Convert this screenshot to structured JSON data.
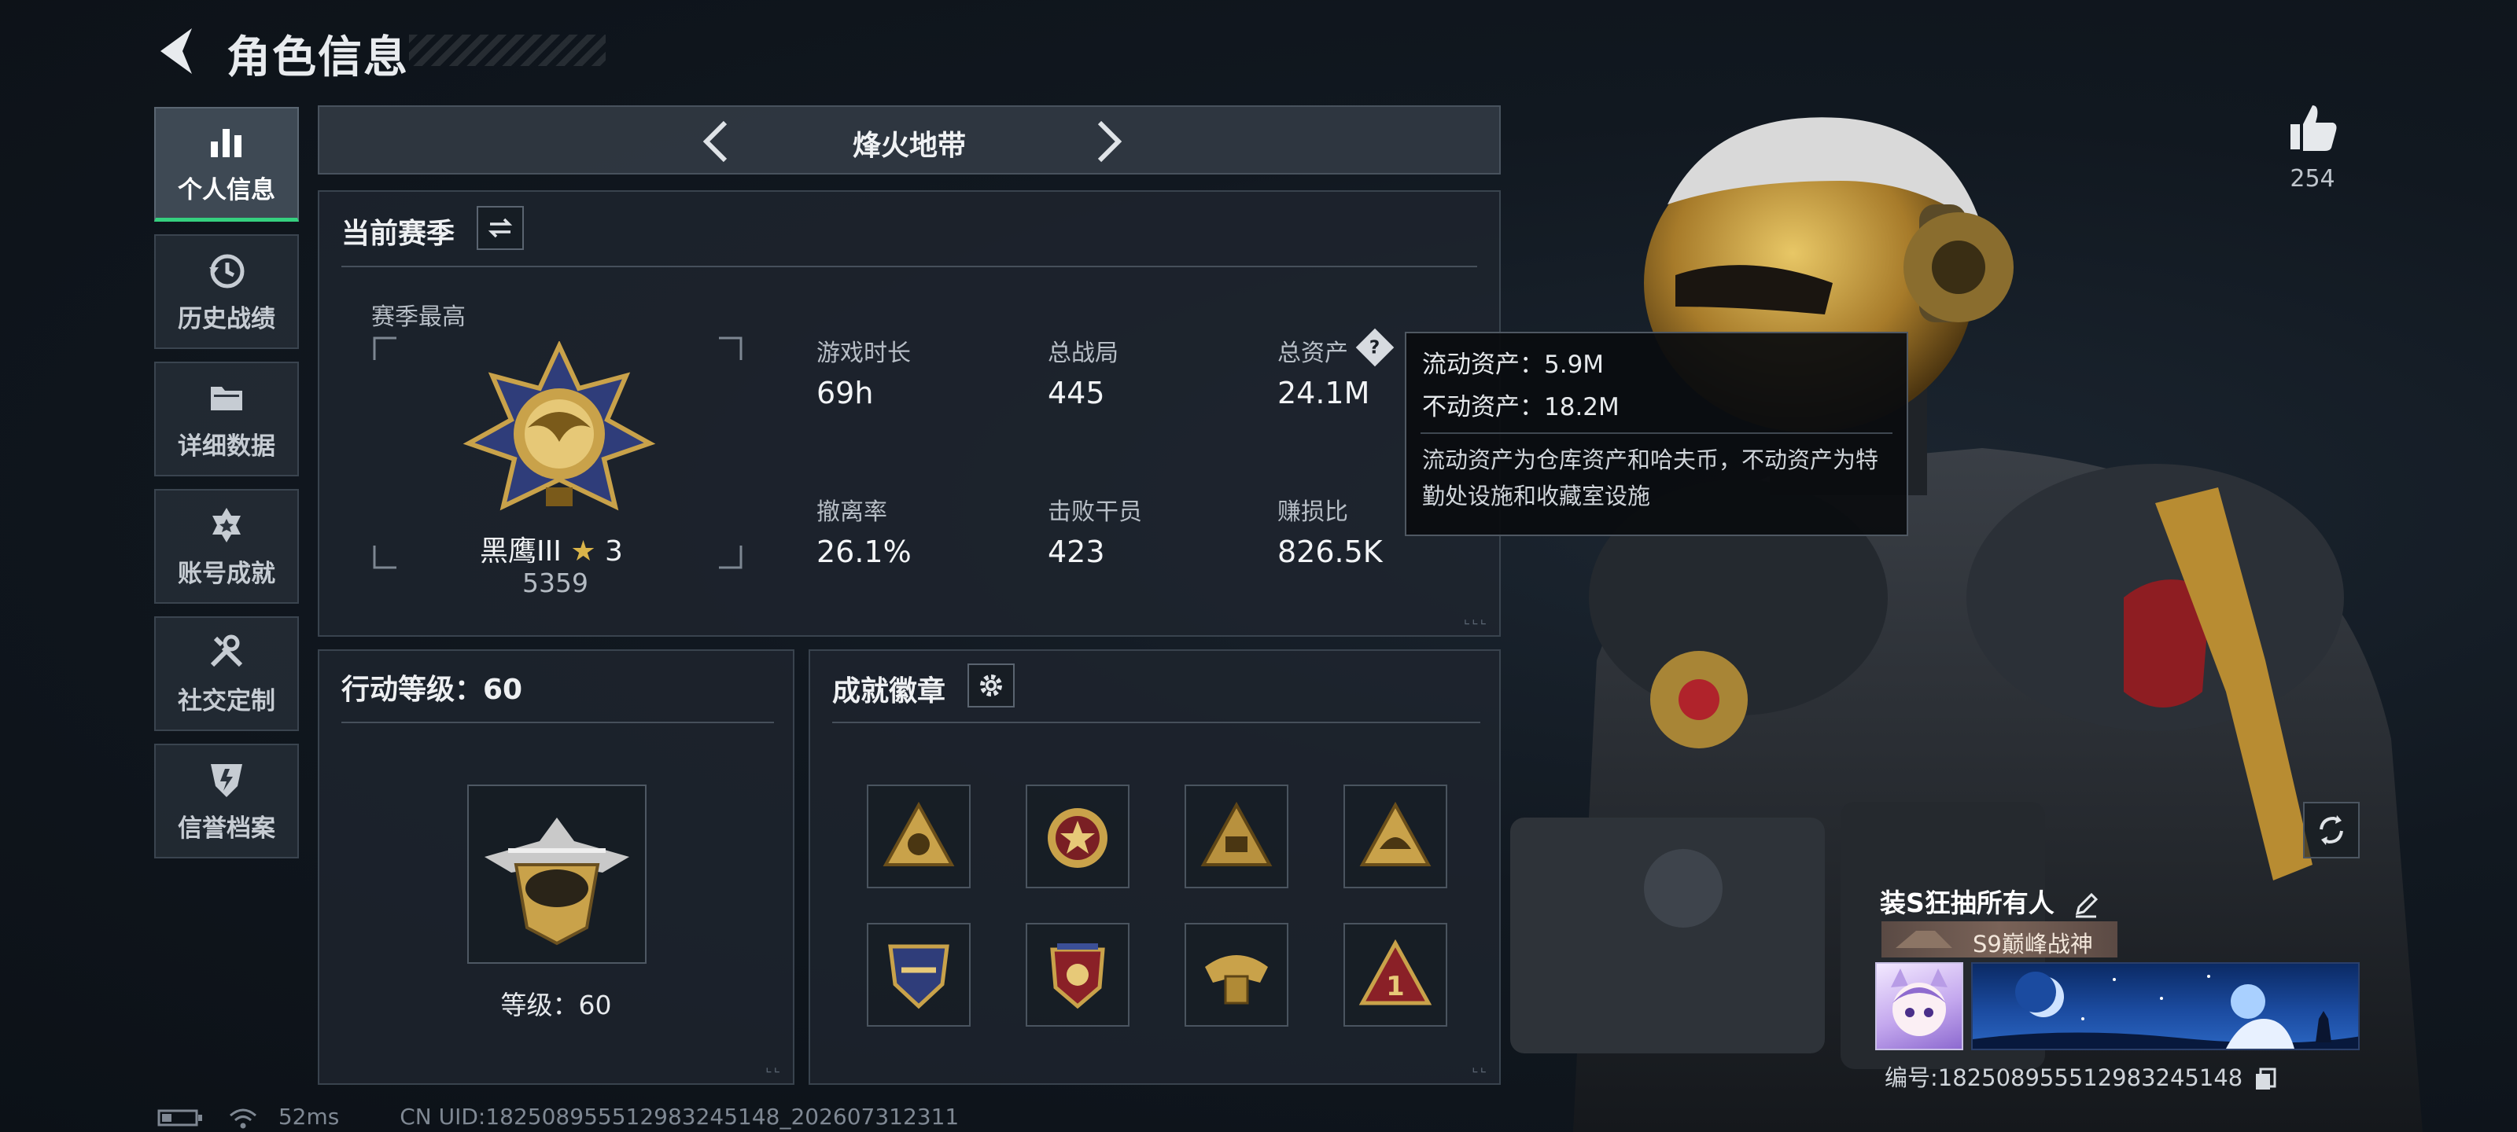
{
  "header": {
    "title": "角色信息"
  },
  "sidebar": {
    "items": [
      {
        "label": "个人信息",
        "icon": "bar-chart-icon",
        "active": true
      },
      {
        "label": "历史战绩",
        "icon": "history-clock-icon",
        "active": false
      },
      {
        "label": "详细数据",
        "icon": "folder-icon",
        "active": false
      },
      {
        "label": "账号成就",
        "icon": "achievement-star-icon",
        "active": false
      },
      {
        "label": "社交定制",
        "icon": "wrench-icon",
        "active": false
      },
      {
        "label": "信誉档案",
        "icon": "credibility-shield-icon",
        "active": false
      }
    ]
  },
  "mode": {
    "name": "烽火地带"
  },
  "season": {
    "title": "当前赛季",
    "best_label": "赛季最高",
    "rank_name": "黑鹰III",
    "rank_stars": "3",
    "rank_score": "5359",
    "stats": [
      {
        "label": "游戏时长",
        "value": "69h"
      },
      {
        "label": "总战局",
        "value": "445"
      },
      {
        "label": "总资产",
        "value": "24.1M"
      },
      {
        "label": "撤离率",
        "value": "26.1%"
      },
      {
        "label": "击败干员",
        "value": "423"
      },
      {
        "label": "赚损比",
        "value": "826.5K"
      }
    ]
  },
  "tooltip": {
    "liquid": "流动资产：5.9M",
    "fixed": "不动资产：18.2M",
    "description": "流动资产为仓库资产和哈夫币，不动资产为特勤处设施和收藏室设施"
  },
  "action_level": {
    "title": "行动等级：60",
    "level_text": "等级：60"
  },
  "achievements": {
    "title": "成就徽章",
    "badges": [
      "badge-1",
      "badge-2",
      "badge-3",
      "badge-4",
      "badge-5",
      "badge-6",
      "badge-7",
      "badge-8"
    ]
  },
  "player": {
    "likes": "254",
    "name": "装S狂抽所有人",
    "title": "S9巅峰战神",
    "id_text": "编号:1825089555129832451​48"
  },
  "status": {
    "ping": "52ms",
    "uid": "CN UID:1825089555129832451​48_202607312311"
  },
  "colors": {
    "accent_green": "#35d07f",
    "gold": "#c9a24a",
    "panel_bg": "#1e252e"
  }
}
